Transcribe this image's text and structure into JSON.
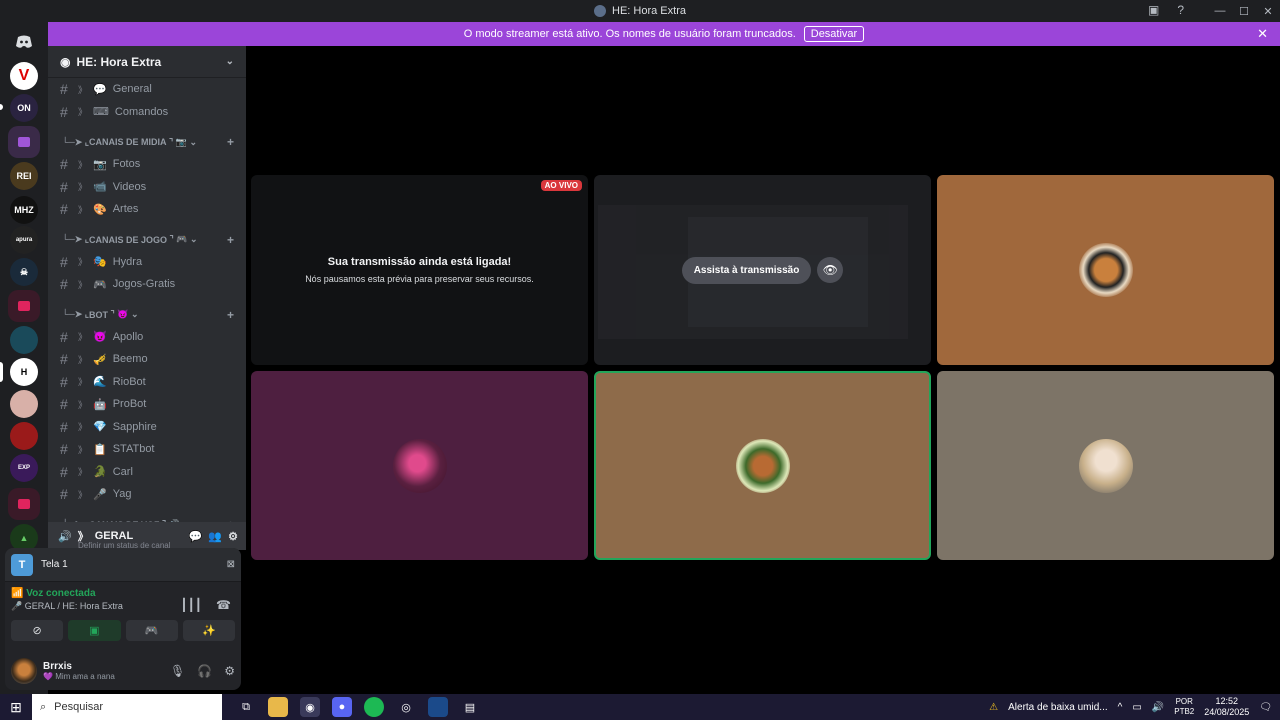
{
  "window": {
    "title": "HE: Hora Extra",
    "controls": [
      "—",
      "☐",
      "✕"
    ]
  },
  "banner": {
    "text": "O modo streamer está ativo. Os nomes de usuário foram truncados.",
    "button": "Desativar"
  },
  "guild": {
    "name": "HE: Hora Extra",
    "channels_top": [
      {
        "icon": "💬",
        "name": "General"
      },
      {
        "icon": "⌨",
        "name": "Comandos"
      }
    ],
    "categories": [
      {
        "label": "CANAIS DE MIDIA",
        "channels": [
          {
            "icon": "📷",
            "name": "Fotos"
          },
          {
            "icon": "📹",
            "name": "Videos"
          },
          {
            "icon": "🎨",
            "name": "Artes"
          }
        ]
      },
      {
        "label": "CANAIS DE JOGO",
        "channels": [
          {
            "icon": "🎭",
            "name": "Hydra"
          },
          {
            "icon": "🎮",
            "name": "Jogos-Gratis"
          }
        ]
      },
      {
        "label": "BOT",
        "channels": [
          {
            "icon": "😈",
            "name": "Apollo"
          },
          {
            "icon": "🎺",
            "name": "Beemo"
          },
          {
            "icon": "🌊",
            "name": "RioBot"
          },
          {
            "icon": "🤖",
            "name": "ProBot"
          },
          {
            "icon": "💎",
            "name": "Sapphire"
          },
          {
            "icon": "📋",
            "name": "STATbot"
          },
          {
            "icon": "🐊",
            "name": "Carl"
          },
          {
            "icon": "🎤",
            "name": "Yag"
          }
        ]
      },
      {
        "label": "CANAIS DE VOZ",
        "channels": []
      }
    ]
  },
  "voice_channel": {
    "name": "GERAL",
    "status_hint": "Definir um status de canal"
  },
  "screen_share": {
    "label": "Tela 1"
  },
  "voice_status": {
    "title": "Voz conectada",
    "location": "GERAL / HE: Hora Extra"
  },
  "user": {
    "name": "Brrxis",
    "status": "Mim ama a nana"
  },
  "tiles": {
    "live_badge": "AO VIVO",
    "preview_title": "Sua transmissão ainda está ligada!",
    "preview_desc": "Nós pausamos esta prévia para preservar seus recursos.",
    "watch_button": "Assista à transmissão"
  },
  "taskbar": {
    "search_placeholder": "Pesquisar",
    "alert": "Alerta de baixa umid...",
    "lang_top": "POR",
    "lang_bottom": "PTB2",
    "time": "12:52",
    "date": "24/08/2025"
  },
  "colors": {
    "banner": "#9b45d9",
    "accent_green": "#23a55a",
    "live_red": "#da373c"
  }
}
